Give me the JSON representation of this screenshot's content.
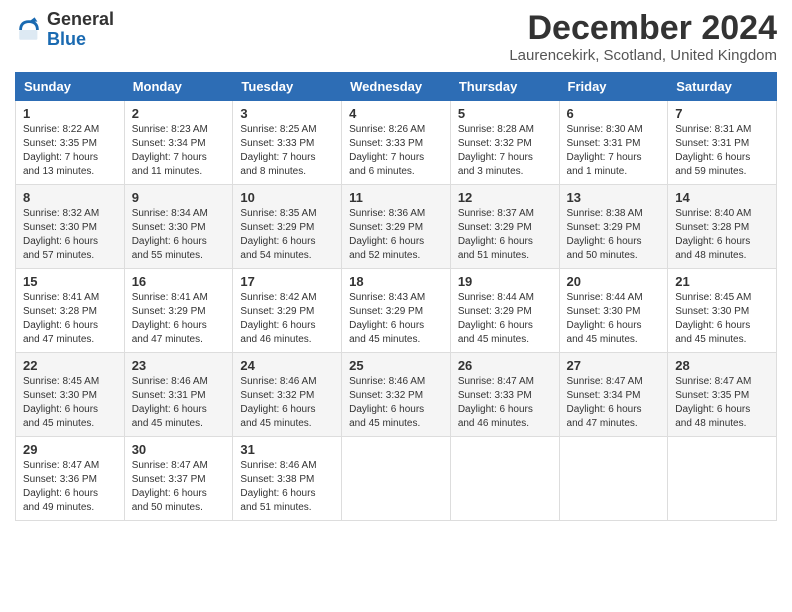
{
  "logo": {
    "general": "General",
    "blue": "Blue"
  },
  "title": "December 2024",
  "location": "Laurencekirk, Scotland, United Kingdom",
  "days_of_week": [
    "Sunday",
    "Monday",
    "Tuesday",
    "Wednesday",
    "Thursday",
    "Friday",
    "Saturday"
  ],
  "weeks": [
    [
      {
        "day": "1",
        "sunrise": "Sunrise: 8:22 AM",
        "sunset": "Sunset: 3:35 PM",
        "daylight": "Daylight: 7 hours and 13 minutes."
      },
      {
        "day": "2",
        "sunrise": "Sunrise: 8:23 AM",
        "sunset": "Sunset: 3:34 PM",
        "daylight": "Daylight: 7 hours and 11 minutes."
      },
      {
        "day": "3",
        "sunrise": "Sunrise: 8:25 AM",
        "sunset": "Sunset: 3:33 PM",
        "daylight": "Daylight: 7 hours and 8 minutes."
      },
      {
        "day": "4",
        "sunrise": "Sunrise: 8:26 AM",
        "sunset": "Sunset: 3:33 PM",
        "daylight": "Daylight: 7 hours and 6 minutes."
      },
      {
        "day": "5",
        "sunrise": "Sunrise: 8:28 AM",
        "sunset": "Sunset: 3:32 PM",
        "daylight": "Daylight: 7 hours and 3 minutes."
      },
      {
        "day": "6",
        "sunrise": "Sunrise: 8:30 AM",
        "sunset": "Sunset: 3:31 PM",
        "daylight": "Daylight: 7 hours and 1 minute."
      },
      {
        "day": "7",
        "sunrise": "Sunrise: 8:31 AM",
        "sunset": "Sunset: 3:31 PM",
        "daylight": "Daylight: 6 hours and 59 minutes."
      }
    ],
    [
      {
        "day": "8",
        "sunrise": "Sunrise: 8:32 AM",
        "sunset": "Sunset: 3:30 PM",
        "daylight": "Daylight: 6 hours and 57 minutes."
      },
      {
        "day": "9",
        "sunrise": "Sunrise: 8:34 AM",
        "sunset": "Sunset: 3:30 PM",
        "daylight": "Daylight: 6 hours and 55 minutes."
      },
      {
        "day": "10",
        "sunrise": "Sunrise: 8:35 AM",
        "sunset": "Sunset: 3:29 PM",
        "daylight": "Daylight: 6 hours and 54 minutes."
      },
      {
        "day": "11",
        "sunrise": "Sunrise: 8:36 AM",
        "sunset": "Sunset: 3:29 PM",
        "daylight": "Daylight: 6 hours and 52 minutes."
      },
      {
        "day": "12",
        "sunrise": "Sunrise: 8:37 AM",
        "sunset": "Sunset: 3:29 PM",
        "daylight": "Daylight: 6 hours and 51 minutes."
      },
      {
        "day": "13",
        "sunrise": "Sunrise: 8:38 AM",
        "sunset": "Sunset: 3:29 PM",
        "daylight": "Daylight: 6 hours and 50 minutes."
      },
      {
        "day": "14",
        "sunrise": "Sunrise: 8:40 AM",
        "sunset": "Sunset: 3:28 PM",
        "daylight": "Daylight: 6 hours and 48 minutes."
      }
    ],
    [
      {
        "day": "15",
        "sunrise": "Sunrise: 8:41 AM",
        "sunset": "Sunset: 3:28 PM",
        "daylight": "Daylight: 6 hours and 47 minutes."
      },
      {
        "day": "16",
        "sunrise": "Sunrise: 8:41 AM",
        "sunset": "Sunset: 3:29 PM",
        "daylight": "Daylight: 6 hours and 47 minutes."
      },
      {
        "day": "17",
        "sunrise": "Sunrise: 8:42 AM",
        "sunset": "Sunset: 3:29 PM",
        "daylight": "Daylight: 6 hours and 46 minutes."
      },
      {
        "day": "18",
        "sunrise": "Sunrise: 8:43 AM",
        "sunset": "Sunset: 3:29 PM",
        "daylight": "Daylight: 6 hours and 45 minutes."
      },
      {
        "day": "19",
        "sunrise": "Sunrise: 8:44 AM",
        "sunset": "Sunset: 3:29 PM",
        "daylight": "Daylight: 6 hours and 45 minutes."
      },
      {
        "day": "20",
        "sunrise": "Sunrise: 8:44 AM",
        "sunset": "Sunset: 3:30 PM",
        "daylight": "Daylight: 6 hours and 45 minutes."
      },
      {
        "day": "21",
        "sunrise": "Sunrise: 8:45 AM",
        "sunset": "Sunset: 3:30 PM",
        "daylight": "Daylight: 6 hours and 45 minutes."
      }
    ],
    [
      {
        "day": "22",
        "sunrise": "Sunrise: 8:45 AM",
        "sunset": "Sunset: 3:30 PM",
        "daylight": "Daylight: 6 hours and 45 minutes."
      },
      {
        "day": "23",
        "sunrise": "Sunrise: 8:46 AM",
        "sunset": "Sunset: 3:31 PM",
        "daylight": "Daylight: 6 hours and 45 minutes."
      },
      {
        "day": "24",
        "sunrise": "Sunrise: 8:46 AM",
        "sunset": "Sunset: 3:32 PM",
        "daylight": "Daylight: 6 hours and 45 minutes."
      },
      {
        "day": "25",
        "sunrise": "Sunrise: 8:46 AM",
        "sunset": "Sunset: 3:32 PM",
        "daylight": "Daylight: 6 hours and 45 minutes."
      },
      {
        "day": "26",
        "sunrise": "Sunrise: 8:47 AM",
        "sunset": "Sunset: 3:33 PM",
        "daylight": "Daylight: 6 hours and 46 minutes."
      },
      {
        "day": "27",
        "sunrise": "Sunrise: 8:47 AM",
        "sunset": "Sunset: 3:34 PM",
        "daylight": "Daylight: 6 hours and 47 minutes."
      },
      {
        "day": "28",
        "sunrise": "Sunrise: 8:47 AM",
        "sunset": "Sunset: 3:35 PM",
        "daylight": "Daylight: 6 hours and 48 minutes."
      }
    ],
    [
      {
        "day": "29",
        "sunrise": "Sunrise: 8:47 AM",
        "sunset": "Sunset: 3:36 PM",
        "daylight": "Daylight: 6 hours and 49 minutes."
      },
      {
        "day": "30",
        "sunrise": "Sunrise: 8:47 AM",
        "sunset": "Sunset: 3:37 PM",
        "daylight": "Daylight: 6 hours and 50 minutes."
      },
      {
        "day": "31",
        "sunrise": "Sunrise: 8:46 AM",
        "sunset": "Sunset: 3:38 PM",
        "daylight": "Daylight: 6 hours and 51 minutes."
      },
      null,
      null,
      null,
      null
    ]
  ]
}
